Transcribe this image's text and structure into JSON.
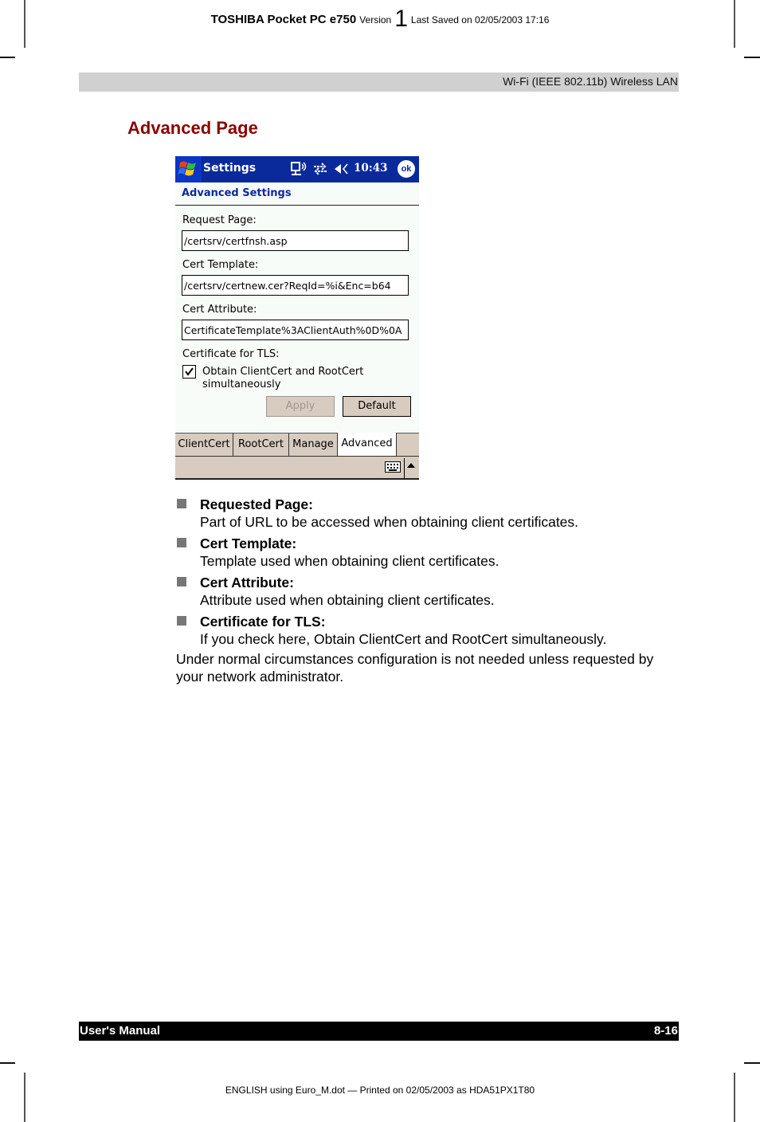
{
  "header": {
    "product": "TOSHIBA Pocket PC e750",
    "version_label": "Version",
    "version_number": "1",
    "last_saved": "Last Saved on 02/05/2003 17:16"
  },
  "section_bar": "Wi-Fi (IEEE 802.11b) Wireless LAN",
  "page_title": "Advanced Page",
  "device": {
    "titlebar": {
      "app_title": "Settings",
      "clock": "10:43",
      "ok_label": "ok",
      "icons": [
        "windows-start-icon",
        "network-icon",
        "connectivity-arrows-icon",
        "volume-icon"
      ]
    },
    "heading": "Advanced Settings",
    "fields": [
      {
        "label": "Request Page:",
        "value": "/certsrv/certfnsh.asp"
      },
      {
        "label": "Cert Template:",
        "value": "/certsrv/certnew.cer?ReqId=%i&Enc=b64"
      },
      {
        "label": "Cert Attribute:",
        "value": "CertificateTemplate%3AClientAuth%0D%0A"
      }
    ],
    "tls": {
      "label": "Certificate for TLS:",
      "checkbox_label": "Obtain ClientCert and RootCert simultaneously",
      "checked": true
    },
    "buttons": {
      "apply": "Apply",
      "default": "Default"
    },
    "tabs": [
      {
        "label": "ClientCert",
        "active": false
      },
      {
        "label": "RootCert",
        "active": false
      },
      {
        "label": "Manage",
        "active": false
      },
      {
        "label": "Advanced",
        "active": true
      }
    ],
    "colors": {
      "titlebar": "#0a2a9c",
      "heading": "#0a2aa0",
      "chrome": "#d8ccc0"
    }
  },
  "bullets": [
    {
      "term": "Requested Page:",
      "desc": "Part of URL to be accessed when obtaining client certificates."
    },
    {
      "term": "Cert Template:",
      "desc": "Template used when obtaining client certificates."
    },
    {
      "term": "Cert Attribute:",
      "desc": "Attribute used when obtaining client certificates."
    },
    {
      "term": "Certificate for TLS:",
      "desc": "If you check here, Obtain ClientCert and RootCert simultaneously."
    }
  ],
  "paragraph": "Under normal circumstances configuration is not needed unless requested by your network administrator.",
  "footer": {
    "left": "User's Manual",
    "right": "8-16",
    "printed": "ENGLISH using Euro_M.dot — Printed on 02/05/2003 as HDA51PX1T80"
  },
  "colors": {
    "title": "#8b0000",
    "section_bar": "#d0d0d0",
    "footer_bar": "#000000"
  }
}
